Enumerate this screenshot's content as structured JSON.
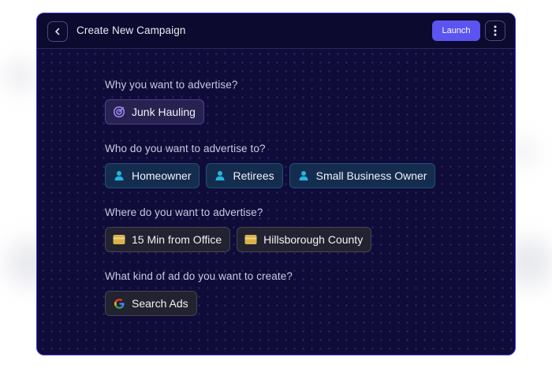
{
  "header": {
    "title": "Create New Campaign",
    "launch_label": "Launch"
  },
  "sections": [
    {
      "question": "Why you want to advertise?",
      "chips": [
        {
          "label": "Junk Hauling",
          "icon": "target-icon"
        }
      ]
    },
    {
      "question": "Who do you want to advertise to?",
      "chips": [
        {
          "label": "Homeowner",
          "icon": "person-icon"
        },
        {
          "label": "Retirees",
          "icon": "person-icon"
        },
        {
          "label": "Small Business Owner",
          "icon": "person-icon"
        }
      ]
    },
    {
      "question": "Where do you want to advertise?",
      "chips": [
        {
          "label": "15 Min from Office",
          "icon": "map-icon"
        },
        {
          "label": "Hillsborough County",
          "icon": "map-icon"
        }
      ]
    },
    {
      "question": "What kind of ad do you want to create?",
      "chips": [
        {
          "label": "Search Ads",
          "icon": "google-icon"
        }
      ]
    }
  ],
  "colors": {
    "accent": "#5b54f0",
    "window_bg": "#0f0c3a",
    "window_border": "#3f37c9",
    "person_icon": "#22b6e0",
    "target_icon": "#a78bfa",
    "map_icon": "#d9b24c"
  }
}
